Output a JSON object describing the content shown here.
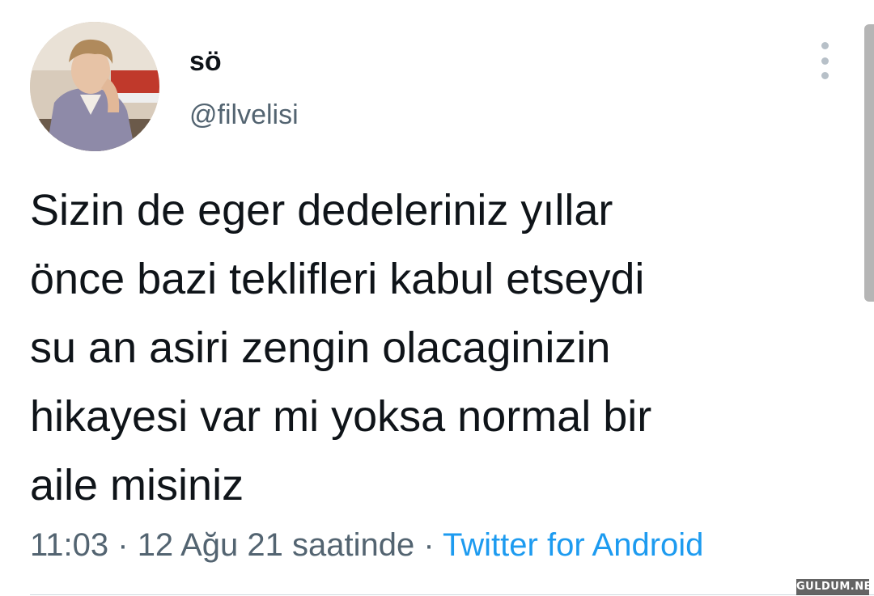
{
  "user": {
    "display_name": "sö",
    "handle": "@filvelisi"
  },
  "tweet": {
    "text_lines": [
      "Sizin de eger dedeleriniz yıllar",
      "önce bazi teklifleri kabul etseydi",
      "su an asiri zengin olacaginizin",
      "hikayesi var mi yoksa normal bir",
      "aile misiniz"
    ],
    "time": "11:03",
    "separator": " · ",
    "date": "12 Ağu 21 saatinde",
    "source": "Twitter for Android"
  },
  "icons": {
    "more": "more-vertical-icon"
  },
  "watermark": "GULDUM.NET",
  "colors": {
    "text": "#0f1419",
    "secondary": "#536471",
    "link": "#1d9bf0"
  }
}
